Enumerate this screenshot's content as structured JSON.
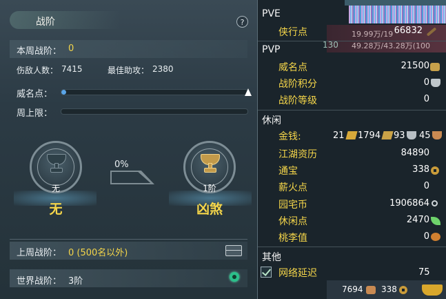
{
  "left_panel": {
    "title": "战阶",
    "help_label": "?",
    "weekly_rank_label": "本周战阶：",
    "weekly_rank_value": "0",
    "kills_label": "伤敌人数：",
    "kills_value": "7415",
    "best_assist_label": "最佳助攻：",
    "best_assist_value": "2380",
    "prestige_label": "威名点：",
    "prestige_progress": 0.02,
    "weekly_cap_label": "周上限：",
    "weekly_cap_progress": 0,
    "current_rank": {
      "medal_label": "无",
      "name": "无"
    },
    "progress_percent": "0%",
    "next_rank": {
      "medal_label": "1阶",
      "name": "凶煞"
    },
    "last_week_label": "上周战阶：",
    "last_week_value": "0 (500名以外)",
    "world_rank_label": "世界战阶：",
    "world_rank_value": "3阶"
  },
  "right_panel": {
    "top_hp_1": "19.99万/19",
    "top_hp_2": "49.28万/43.28万(100",
    "top_level": "130",
    "pve": {
      "header": "PVE",
      "items": [
        {
          "label": "侠行点",
          "value": "66832",
          "icon": "sword-icon"
        }
      ]
    },
    "pvp": {
      "header": "PVP",
      "items": [
        {
          "label": "威名点",
          "value": "21500",
          "icon": "mask-icon"
        },
        {
          "label": "战阶积分",
          "value": "0",
          "icon": "trophy-icon"
        },
        {
          "label": "战阶等级",
          "value": "0",
          "icon": ""
        }
      ]
    },
    "leisure": {
      "header": "休闲",
      "money_label": "金钱:",
      "money_gold": "21",
      "money_silver_ingot": "1794",
      "money_silver": "93",
      "money_copper": "45",
      "items": [
        {
          "label": "江湖资历",
          "value": "84890",
          "icon": ""
        },
        {
          "label": "通宝",
          "value": "338",
          "icon": "coin-icon"
        },
        {
          "label": "薪火点",
          "value": "0",
          "icon": ""
        },
        {
          "label": "园宅币",
          "value": "1906864",
          "icon": "hook-icon"
        },
        {
          "label": "休闲点",
          "value": "2470",
          "icon": "leaf-icon"
        },
        {
          "label": "桃李值",
          "value": "0",
          "icon": "gourd-icon"
        }
      ]
    },
    "other": {
      "header": "其他",
      "latency_label": "网络延迟",
      "latency_value": "75"
    },
    "bottom": {
      "currency_a": "7694",
      "currency_b": "338"
    }
  }
}
